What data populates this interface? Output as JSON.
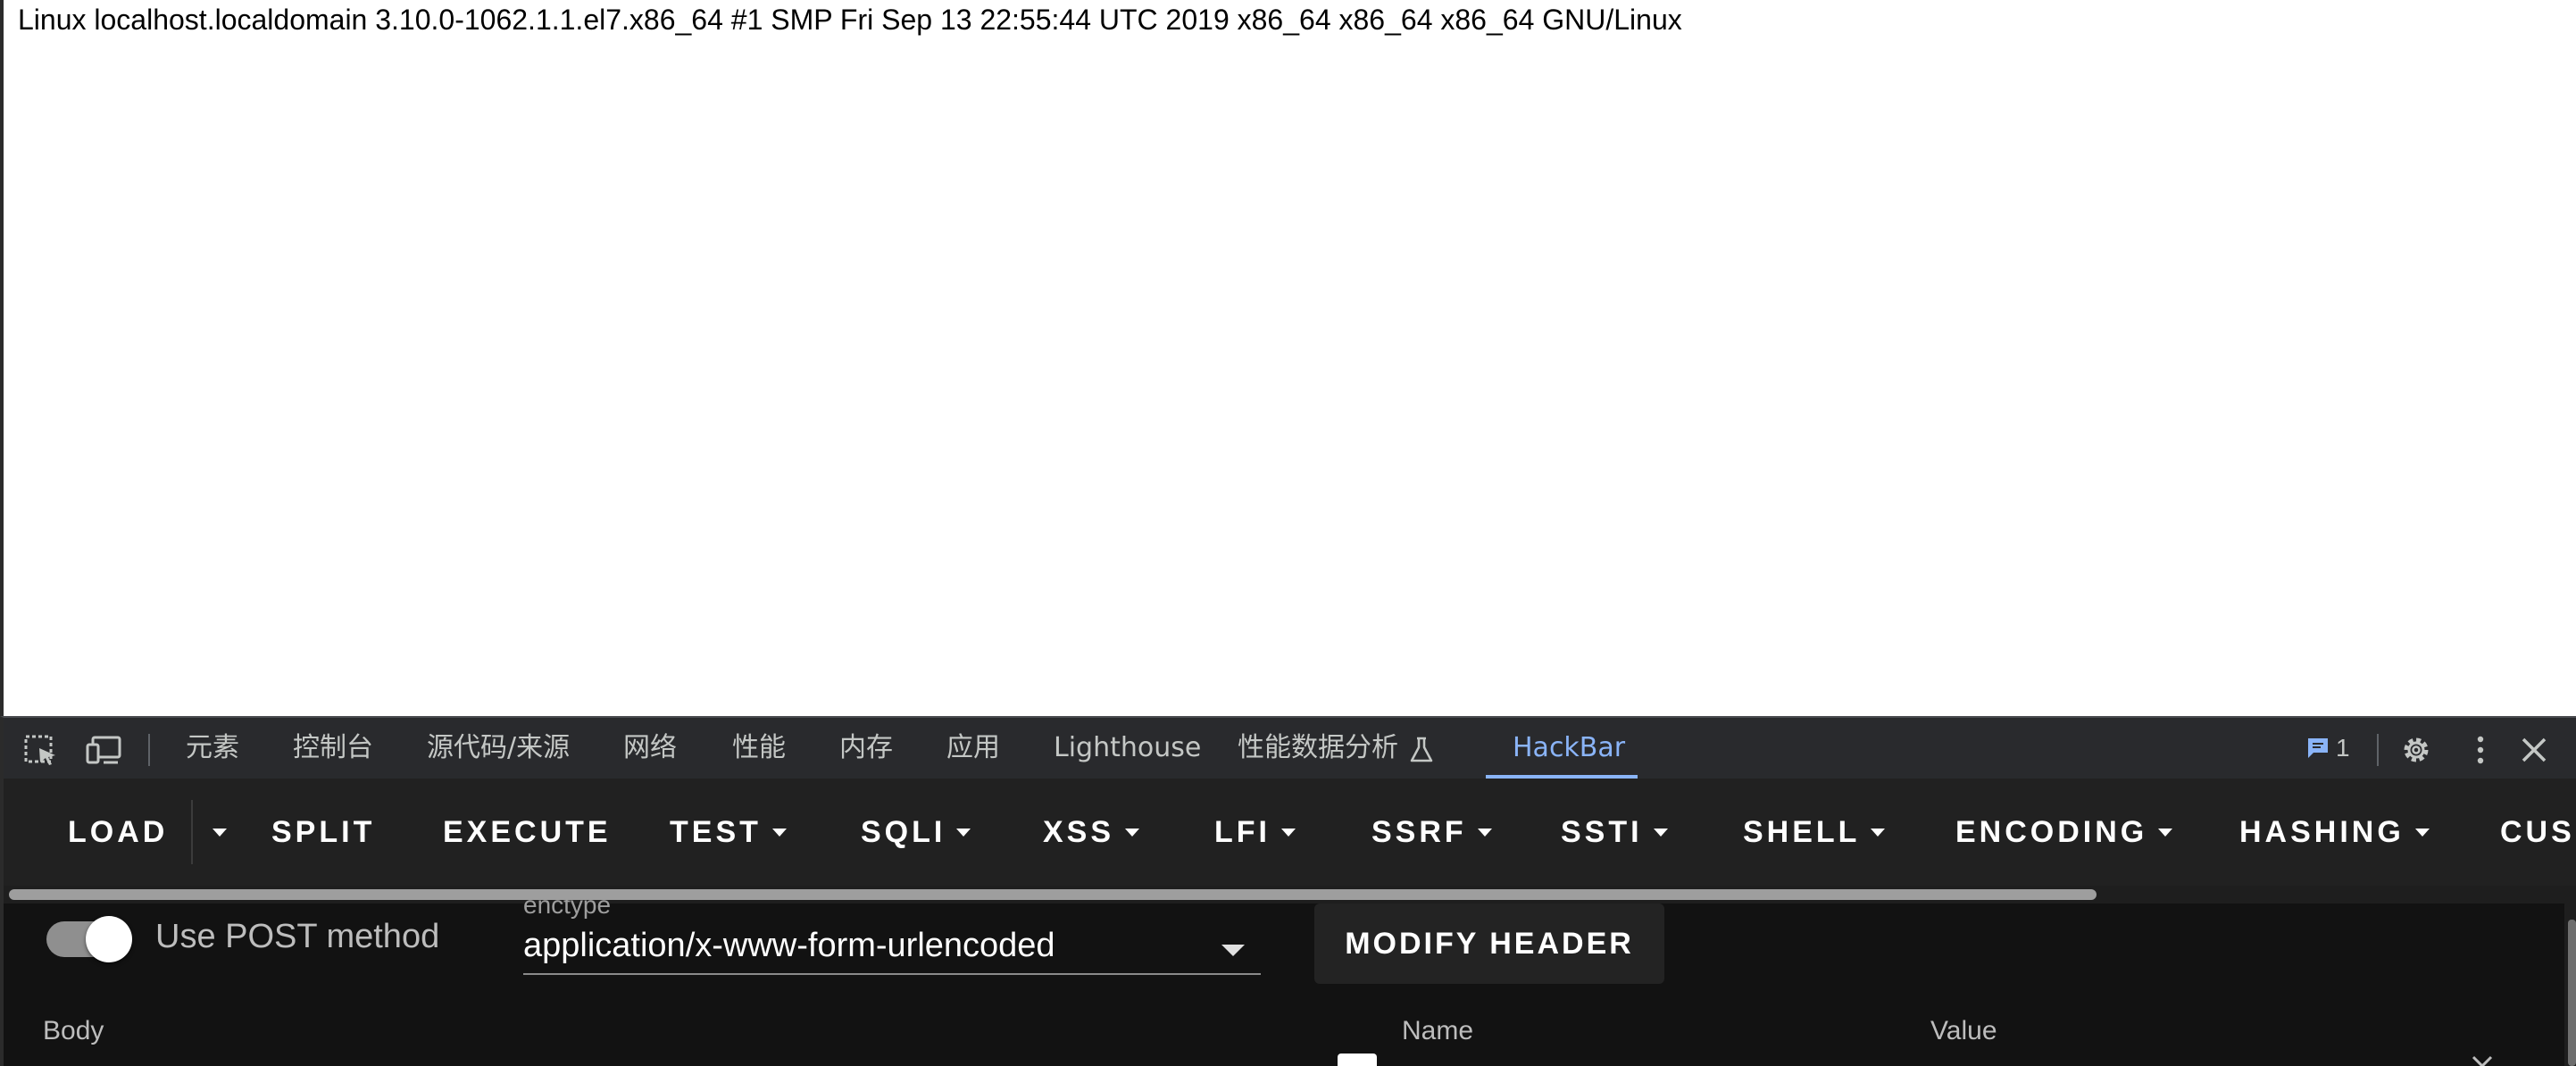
{
  "page": {
    "content": "Linux localhost.localdomain 3.10.0-1062.1.1.el7.x86_64 #1 SMP Fri Sep 13 22:55:44 UTC 2019 x86_64 x86_64 x86_64 GNU/Linux"
  },
  "devtools": {
    "tabs": {
      "elements": "元素",
      "console": "控制台",
      "sources": "源代码/来源",
      "network": "网络",
      "performance": "性能",
      "memory": "内存",
      "application": "应用",
      "lighthouse": "Lighthouse",
      "perf_insights": "性能数据分析",
      "hackbar": "HackBar"
    },
    "issues_count": "1",
    "accent_color": "#8ab4f8"
  },
  "hackbar": {
    "toolbar": {
      "load": "LOAD",
      "split": "SPLIT",
      "execute": "EXECUTE",
      "test": "TEST",
      "sqli": "SQLI",
      "xss": "XSS",
      "lfi": "LFI",
      "ssrf": "SSRF",
      "ssti": "SSTI",
      "shell": "SHELL",
      "encoding": "ENCODING",
      "hashing": "HASHING",
      "custom": "CUS"
    },
    "post_method_label": "Use POST method",
    "post_method_enabled": true,
    "enctype_label": "enctype",
    "enctype_value": "application/x-www-form-urlencoded",
    "modify_header": "MODIFY HEADER",
    "body_label": "Body",
    "name_label": "Name",
    "value_label": "Value"
  }
}
